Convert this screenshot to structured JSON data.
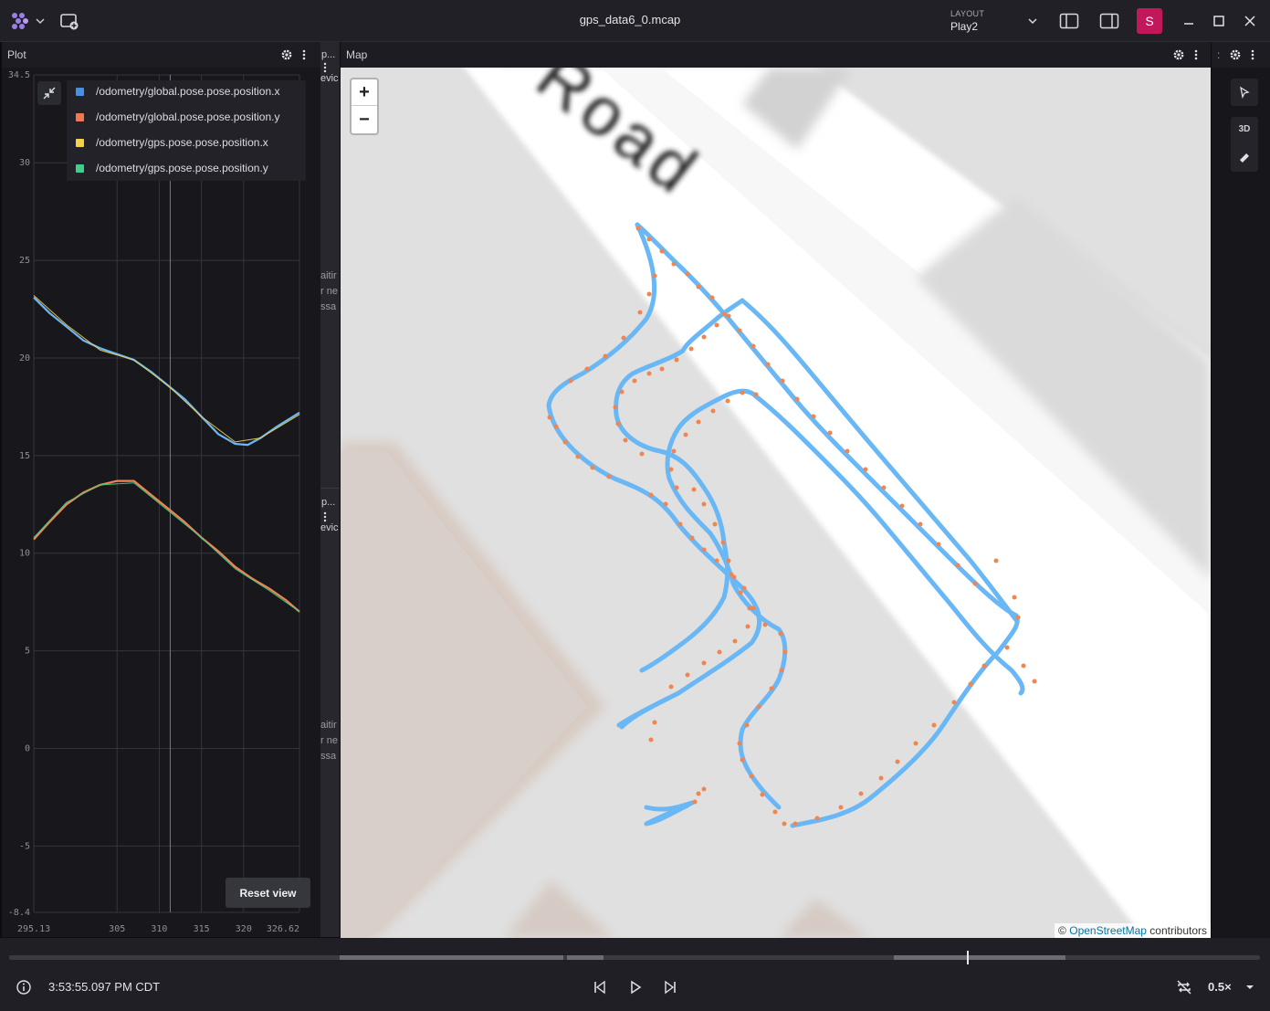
{
  "app": {
    "file_title": "gps_data6_0.mcap"
  },
  "layout": {
    "label": "LAYOUT",
    "name": "Play2"
  },
  "user": {
    "initial": "S"
  },
  "plot_panel": {
    "title": "Plot",
    "legend": [
      {
        "label": "/odometry/global.pose.pose.position.x",
        "color": "#4a90e2"
      },
      {
        "label": "/odometry/global.pose.pose.position.y",
        "color": "#f07850"
      },
      {
        "label": "/odometry/gps.pose.pose.position.x",
        "color": "#f5d04a"
      },
      {
        "label": "/odometry/gps.pose.pose.position.y",
        "color": "#3ecf8e"
      }
    ],
    "y_tick_labels": [
      "34.5",
      "30",
      "25",
      "20",
      "15",
      "10",
      "5",
      "0",
      "-5",
      "-8.4"
    ],
    "x_tick_labels": [
      "295.13",
      "305",
      "310",
      "315",
      "320",
      "326.62"
    ],
    "reset_button": "Reset view"
  },
  "side_strip": {
    "top_title": "p...",
    "top_sub": "evic",
    "top_msg": [
      "aitir",
      "r ne",
      "ssa"
    ],
    "bottom_title": "p...",
    "bottom_sub": "evic",
    "bottom_msg": [
      "aitir",
      "r ne",
      "ssa"
    ]
  },
  "map_panel": {
    "title": "Map",
    "zoom_in": "+",
    "zoom_out": "−",
    "attribution_prefix": "©",
    "attribution_link": "OpenStreetMap",
    "attribution_suffix": "contributors",
    "road_label": "Road"
  },
  "right_toolbar": {
    "mode_3d": "3D"
  },
  "playback": {
    "time": "3:53:55.097 PM CDT",
    "speed": "0.5×"
  },
  "colors": {
    "accent": "#c2185b",
    "series_global": "#6ab7f5",
    "series_gps": "#f2844f"
  },
  "chart_data": {
    "type": "line",
    "xlim": [
      295.13,
      326.62
    ],
    "ylim": [
      -8.4,
      34.5
    ],
    "series": [
      {
        "name": "/odometry/global.pose.pose.position.x",
        "x": [
          295.13,
          297,
          299,
          301,
          303,
          305,
          307,
          309,
          311,
          313,
          315,
          317,
          319,
          320.5,
          322,
          324,
          326.62
        ],
        "y": [
          23.1,
          22.3,
          21.6,
          20.9,
          20.5,
          20.2,
          19.9,
          19.3,
          18.6,
          17.9,
          17.0,
          16.1,
          15.6,
          15.55,
          15.9,
          16.5,
          17.2
        ]
      },
      {
        "name": "/odometry/global.pose.pose.position.y",
        "x": [
          295.13,
          297,
          299,
          301,
          303,
          305,
          307,
          309,
          311,
          313,
          315,
          317,
          319,
          321,
          323,
          325,
          326.62
        ],
        "y": [
          10.7,
          11.6,
          12.5,
          13.1,
          13.5,
          13.7,
          13.7,
          13.0,
          12.3,
          11.6,
          10.8,
          10.1,
          9.3,
          8.7,
          8.2,
          7.6,
          7.0
        ]
      },
      {
        "name": "/odometry/gps.pose.pose.position.x",
        "x": [
          295.13,
          299,
          303,
          307,
          311,
          315,
          319,
          322,
          326.62
        ],
        "y": [
          23.2,
          21.7,
          20.4,
          19.9,
          18.6,
          17.0,
          15.7,
          15.9,
          17.1
        ]
      },
      {
        "name": "/odometry/gps.pose.pose.position.y",
        "x": [
          295.13,
          299,
          303,
          307,
          311,
          315,
          319,
          323,
          326.62
        ],
        "y": [
          10.8,
          12.6,
          13.5,
          13.6,
          12.2,
          10.8,
          9.2,
          8.1,
          7.0
        ]
      }
    ]
  }
}
